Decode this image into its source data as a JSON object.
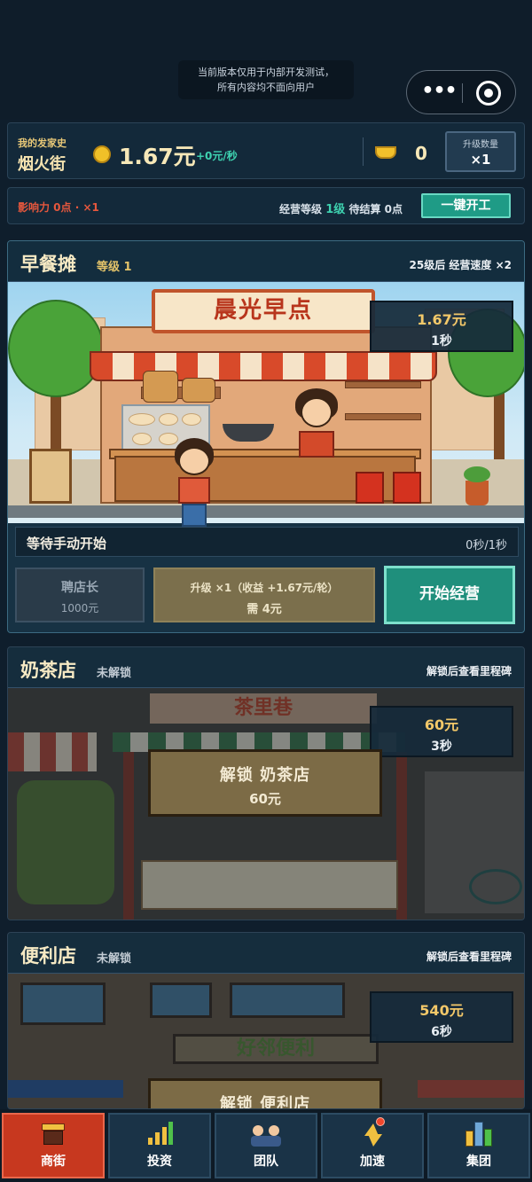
{
  "system": {
    "notice_line1": "当前版本仅用于内部开发测试，",
    "notice_line2": "所有内容均不面向用户"
  },
  "hud": {
    "history_label": "我的发家史",
    "street_name": "烟火街",
    "money": "1.67元",
    "rate": "+0元/秒",
    "ingots": "0",
    "upgrade_qty_label": "升级数量",
    "upgrade_qty_value": "×1"
  },
  "infobar": {
    "influence": "影响力 0点 · ×1",
    "level_label": "经营等级",
    "level_value": "1级",
    "pending": "待结算 0点",
    "one_click": "一键开工"
  },
  "shops": [
    {
      "name": "早餐摊",
      "tag": "等级 1",
      "milestone": "25级后 经营速度 ×2",
      "sign": "晨光早点",
      "price": "1.67元",
      "time": "1秒",
      "status": "等待手动开始",
      "progress_text": "0秒/1秒",
      "hire_label": "聘店长",
      "hire_cost": "1000元",
      "upgrade_label": "升级 ×1（收益 +1.67元/轮）",
      "upgrade_cost": "需 4元",
      "start_label": "开始经营"
    },
    {
      "name": "奶茶店",
      "tag": "未解锁",
      "milestone": "解锁后查看里程碑",
      "sign": "茶里巷",
      "price": "60元",
      "time": "3秒",
      "unlock_label": "解锁 奶茶店",
      "unlock_cost": "60元"
    },
    {
      "name": "便利店",
      "tag": "未解锁",
      "milestone": "解锁后查看里程碑",
      "sign": "好邻便利",
      "price": "540元",
      "time": "6秒",
      "unlock_label": "解锁 便利店"
    }
  ],
  "tabs": [
    {
      "label": "商街",
      "icon": "storefront-icon",
      "active": true
    },
    {
      "label": "投资",
      "icon": "chart-up-icon"
    },
    {
      "label": "团队",
      "icon": "team-icon"
    },
    {
      "label": "加速",
      "icon": "lightning-icon",
      "badge": true
    },
    {
      "label": "集团",
      "icon": "skyscraper-icon"
    }
  ],
  "colors": {
    "accent_teal": "#1f9b86",
    "active_tab": "#c7381f",
    "gold": "#f3c869",
    "influence_red": "#e5573d"
  }
}
